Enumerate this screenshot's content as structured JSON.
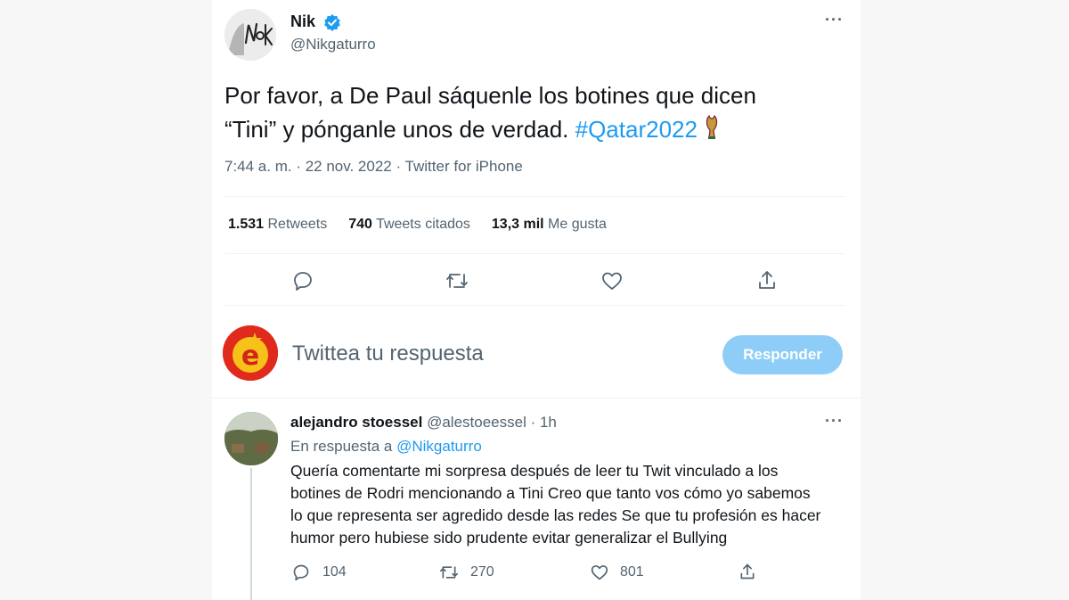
{
  "tweet": {
    "author_name": "Nik",
    "author_handle": "@Nikgaturro",
    "more_label": "···",
    "text_line1": "Por favor, a De Paul sáquenle los botines que dicen",
    "text_line2": "“Tini” y pónganle unos de verdad.",
    "hashtag": "#Qatar2022",
    "meta": "7:44 a. m. · 22 nov. 2022 · Twitter for iPhone",
    "stats": {
      "retweets_count": "1.531",
      "retweets_label": "Retweets",
      "quotes_count": "740",
      "quotes_label": "Tweets citados",
      "likes_count": "13,3 mil",
      "likes_label": "Me gusta"
    }
  },
  "compose": {
    "placeholder": "Twittea tu respuesta",
    "button_label": "Responder"
  },
  "reply": {
    "author_name": "alejandro stoessel",
    "author_handle": "@alestoeessel",
    "time": "· 1h",
    "more_label": "···",
    "replying_prefix": "En respuesta a",
    "replying_to": "@Nikgaturro",
    "body_lines": [
      "Quería comentarte mi sorpresa después de leer tu Twit vinculado a los",
      "botines de Rodri mencionando a Tini Creo que tanto vos cómo yo sabemos",
      "lo que representa ser agredido desde las redes Se que tu profesión es hacer",
      "humor pero hubiese sido prudente evitar generalizar el Bullying"
    ],
    "reply_count": "104",
    "retweet_count": "270",
    "like_count": "801"
  },
  "icons": {
    "verified": "verified-badge-icon",
    "reply": "reply-icon",
    "retweet": "retweet-icon",
    "like": "heart-icon",
    "share": "share-icon"
  },
  "colors": {
    "accent": "#1d9bf0",
    "button_disabled": "#8ecdf8",
    "muted_text": "#536471"
  }
}
